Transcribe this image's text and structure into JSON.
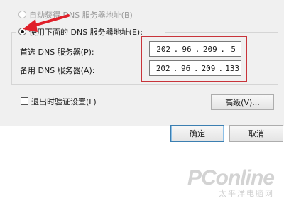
{
  "dns": {
    "auto_option_label": "自动获得 DNS 服务器地址(B)",
    "manual_option_label": "使用下面的 DNS 服务器地址(E):",
    "preferred": {
      "label": "首选 DNS 服务器(P):",
      "octets": [
        "202",
        "96",
        "209",
        "5"
      ]
    },
    "alternate": {
      "label": "备用 DNS 服务器(A):",
      "octets": [
        "202",
        "96",
        "209",
        "133"
      ]
    }
  },
  "validate_checkbox_label": "退出时验证设置(L)",
  "advanced_button": "高级(V)...",
  "ok_button": "确定",
  "cancel_button": "取消",
  "watermark": {
    "brand": "PConline",
    "tagline": "太平洋电脑网"
  },
  "colors": {
    "highlight_box": "#c8343a",
    "arrow": "#e0202a",
    "dialog_bg": "#f0f0f0"
  }
}
